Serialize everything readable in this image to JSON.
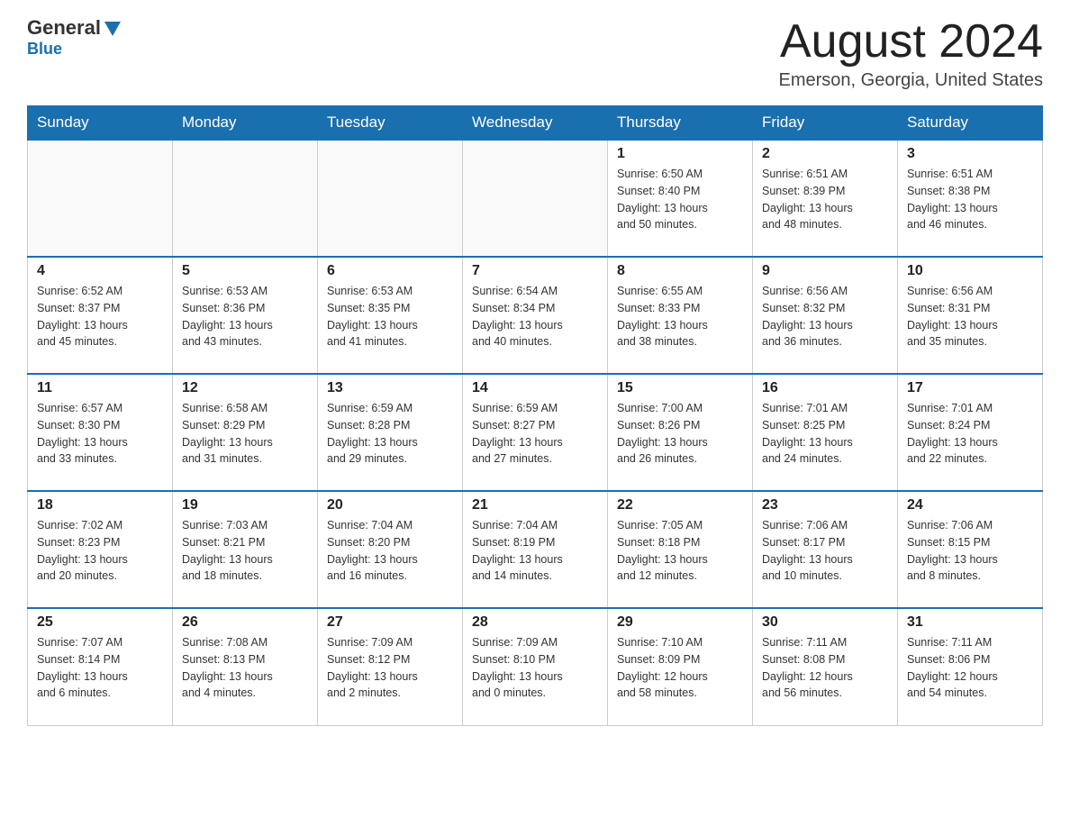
{
  "header": {
    "logo_general": "General",
    "logo_blue": "Blue",
    "month_title": "August 2024",
    "location": "Emerson, Georgia, United States"
  },
  "days_of_week": [
    "Sunday",
    "Monday",
    "Tuesday",
    "Wednesday",
    "Thursday",
    "Friday",
    "Saturday"
  ],
  "weeks": [
    {
      "cells": [
        {
          "day": "",
          "info": ""
        },
        {
          "day": "",
          "info": ""
        },
        {
          "day": "",
          "info": ""
        },
        {
          "day": "",
          "info": ""
        },
        {
          "day": "1",
          "info": "Sunrise: 6:50 AM\nSunset: 8:40 PM\nDaylight: 13 hours\nand 50 minutes."
        },
        {
          "day": "2",
          "info": "Sunrise: 6:51 AM\nSunset: 8:39 PM\nDaylight: 13 hours\nand 48 minutes."
        },
        {
          "day": "3",
          "info": "Sunrise: 6:51 AM\nSunset: 8:38 PM\nDaylight: 13 hours\nand 46 minutes."
        }
      ]
    },
    {
      "cells": [
        {
          "day": "4",
          "info": "Sunrise: 6:52 AM\nSunset: 8:37 PM\nDaylight: 13 hours\nand 45 minutes."
        },
        {
          "day": "5",
          "info": "Sunrise: 6:53 AM\nSunset: 8:36 PM\nDaylight: 13 hours\nand 43 minutes."
        },
        {
          "day": "6",
          "info": "Sunrise: 6:53 AM\nSunset: 8:35 PM\nDaylight: 13 hours\nand 41 minutes."
        },
        {
          "day": "7",
          "info": "Sunrise: 6:54 AM\nSunset: 8:34 PM\nDaylight: 13 hours\nand 40 minutes."
        },
        {
          "day": "8",
          "info": "Sunrise: 6:55 AM\nSunset: 8:33 PM\nDaylight: 13 hours\nand 38 minutes."
        },
        {
          "day": "9",
          "info": "Sunrise: 6:56 AM\nSunset: 8:32 PM\nDaylight: 13 hours\nand 36 minutes."
        },
        {
          "day": "10",
          "info": "Sunrise: 6:56 AM\nSunset: 8:31 PM\nDaylight: 13 hours\nand 35 minutes."
        }
      ]
    },
    {
      "cells": [
        {
          "day": "11",
          "info": "Sunrise: 6:57 AM\nSunset: 8:30 PM\nDaylight: 13 hours\nand 33 minutes."
        },
        {
          "day": "12",
          "info": "Sunrise: 6:58 AM\nSunset: 8:29 PM\nDaylight: 13 hours\nand 31 minutes."
        },
        {
          "day": "13",
          "info": "Sunrise: 6:59 AM\nSunset: 8:28 PM\nDaylight: 13 hours\nand 29 minutes."
        },
        {
          "day": "14",
          "info": "Sunrise: 6:59 AM\nSunset: 8:27 PM\nDaylight: 13 hours\nand 27 minutes."
        },
        {
          "day": "15",
          "info": "Sunrise: 7:00 AM\nSunset: 8:26 PM\nDaylight: 13 hours\nand 26 minutes."
        },
        {
          "day": "16",
          "info": "Sunrise: 7:01 AM\nSunset: 8:25 PM\nDaylight: 13 hours\nand 24 minutes."
        },
        {
          "day": "17",
          "info": "Sunrise: 7:01 AM\nSunset: 8:24 PM\nDaylight: 13 hours\nand 22 minutes."
        }
      ]
    },
    {
      "cells": [
        {
          "day": "18",
          "info": "Sunrise: 7:02 AM\nSunset: 8:23 PM\nDaylight: 13 hours\nand 20 minutes."
        },
        {
          "day": "19",
          "info": "Sunrise: 7:03 AM\nSunset: 8:21 PM\nDaylight: 13 hours\nand 18 minutes."
        },
        {
          "day": "20",
          "info": "Sunrise: 7:04 AM\nSunset: 8:20 PM\nDaylight: 13 hours\nand 16 minutes."
        },
        {
          "day": "21",
          "info": "Sunrise: 7:04 AM\nSunset: 8:19 PM\nDaylight: 13 hours\nand 14 minutes."
        },
        {
          "day": "22",
          "info": "Sunrise: 7:05 AM\nSunset: 8:18 PM\nDaylight: 13 hours\nand 12 minutes."
        },
        {
          "day": "23",
          "info": "Sunrise: 7:06 AM\nSunset: 8:17 PM\nDaylight: 13 hours\nand 10 minutes."
        },
        {
          "day": "24",
          "info": "Sunrise: 7:06 AM\nSunset: 8:15 PM\nDaylight: 13 hours\nand 8 minutes."
        }
      ]
    },
    {
      "cells": [
        {
          "day": "25",
          "info": "Sunrise: 7:07 AM\nSunset: 8:14 PM\nDaylight: 13 hours\nand 6 minutes."
        },
        {
          "day": "26",
          "info": "Sunrise: 7:08 AM\nSunset: 8:13 PM\nDaylight: 13 hours\nand 4 minutes."
        },
        {
          "day": "27",
          "info": "Sunrise: 7:09 AM\nSunset: 8:12 PM\nDaylight: 13 hours\nand 2 minutes."
        },
        {
          "day": "28",
          "info": "Sunrise: 7:09 AM\nSunset: 8:10 PM\nDaylight: 13 hours\nand 0 minutes."
        },
        {
          "day": "29",
          "info": "Sunrise: 7:10 AM\nSunset: 8:09 PM\nDaylight: 12 hours\nand 58 minutes."
        },
        {
          "day": "30",
          "info": "Sunrise: 7:11 AM\nSunset: 8:08 PM\nDaylight: 12 hours\nand 56 minutes."
        },
        {
          "day": "31",
          "info": "Sunrise: 7:11 AM\nSunset: 8:06 PM\nDaylight: 12 hours\nand 54 minutes."
        }
      ]
    }
  ]
}
